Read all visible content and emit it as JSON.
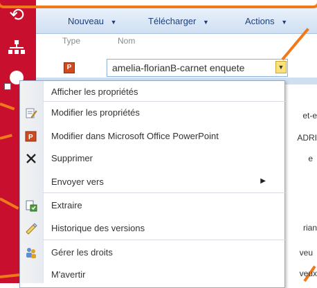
{
  "toolbar": {
    "nouveau": "Nouveau",
    "telecharger": "Télécharger",
    "actions": "Actions",
    "caret": "▼"
  },
  "columns": {
    "type": "Type",
    "nom": "Nom"
  },
  "file": {
    "name": "amelia-florianB-carnet enquete",
    "dropdown": "▼",
    "icon_glyph": "P"
  },
  "menu": {
    "items": [
      {
        "label": "Afficher les propriétés",
        "icon": "none"
      },
      {
        "label": "Modifier les propriétés",
        "icon": "edit-properties-icon"
      },
      {
        "label": "Modifier dans Microsoft Office PowerPoint",
        "icon": "powerpoint-icon"
      },
      {
        "label": "Supprimer",
        "icon": "delete-x-icon"
      },
      {
        "label": "Envoyer vers",
        "icon": "none",
        "submenu": "▶"
      },
      {
        "label": "Extraire",
        "icon": "checkout-icon"
      },
      {
        "label": "Historique des versions",
        "icon": "version-history-icon"
      },
      {
        "label": "Gérer les droits",
        "icon": "manage-permissions-icon"
      },
      {
        "label": "M'avertir",
        "icon": "none"
      }
    ]
  },
  "peek": [
    "et-e",
    "ADRI",
    "e",
    "rian",
    "veu",
    "veux"
  ],
  "colors": {
    "brand_red": "#c8102e",
    "annotation_orange": "#f07a1a",
    "toolbar_text": "#1e3f7a"
  }
}
